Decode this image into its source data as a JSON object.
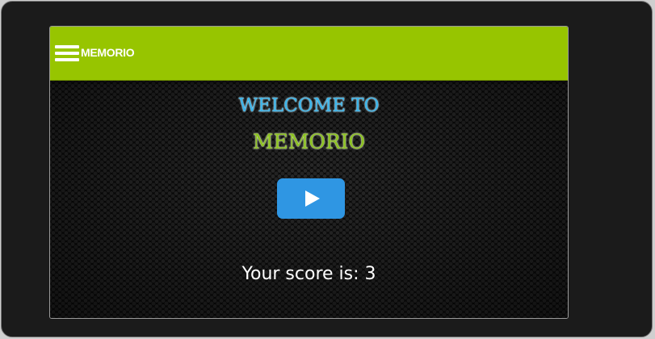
{
  "app": {
    "brand": "MEMORIO"
  },
  "main": {
    "welcome_text": "WELCOME TO",
    "title_text": "MEMORIO",
    "score_text": "Your score is: 3",
    "score": 3
  },
  "icons": {
    "menu": "hamburger-menu-icon",
    "play": "play-icon"
  },
  "colors": {
    "topbar": "#97c500",
    "welcome": "#39b4ea",
    "title": "#8cc21f",
    "play_button": "#2f96e3"
  }
}
